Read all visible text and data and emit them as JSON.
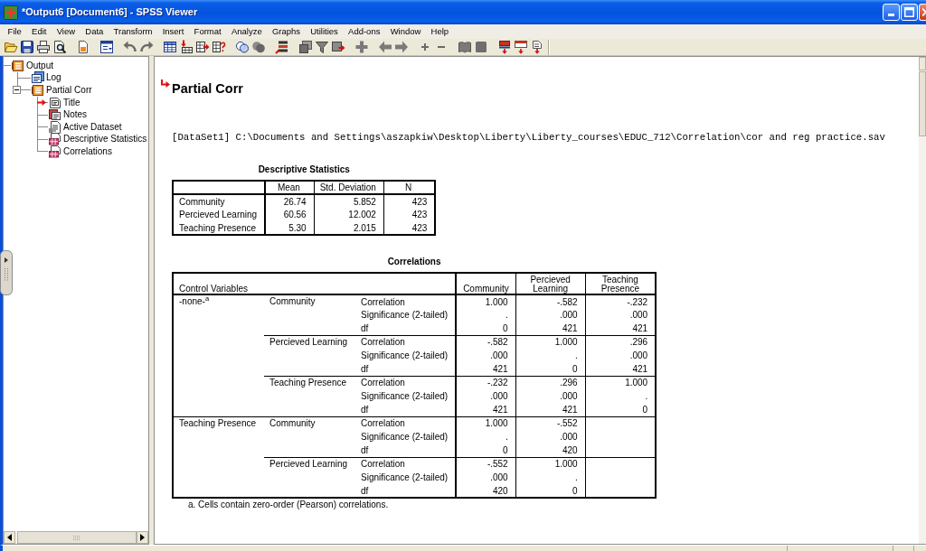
{
  "window": {
    "title": "*Output6 [Document6] - SPSS Viewer"
  },
  "menu": [
    "File",
    "Edit",
    "View",
    "Data",
    "Transform",
    "Insert",
    "Format",
    "Analyze",
    "Graphs",
    "Utilities",
    "Add-ons",
    "Window",
    "Help"
  ],
  "outline": [
    {
      "label": "Output",
      "kind": "heading",
      "current": false,
      "children": [
        {
          "label": "Log",
          "kind": "log",
          "current": false
        },
        {
          "label": "Partial Corr",
          "kind": "heading",
          "current": false,
          "expanded": true,
          "children": [
            {
              "label": "Title",
              "kind": "title",
              "current": true
            },
            {
              "label": "Notes",
              "kind": "notes",
              "current": false
            },
            {
              "label": "Active Dataset",
              "kind": "text",
              "current": false
            },
            {
              "label": "Descriptive Statistics",
              "kind": "table",
              "current": false
            },
            {
              "label": "Correlations",
              "kind": "table",
              "current": false
            }
          ]
        }
      ]
    }
  ],
  "output": {
    "title": {
      "text": "Partial Corr",
      "current": true
    },
    "dataset_line": "[DataSet1] C:\\Documents and Settings\\aszapkiw\\Desktop\\Liberty\\Liberty_courses\\EDUC_712\\Correlation\\cor and reg practice.sav",
    "descriptive_statistics": {
      "title": "Descriptive Statistics",
      "columns": [
        "Mean",
        "Std. Deviation",
        "N"
      ],
      "rows": [
        {
          "label": "Community",
          "cells": [
            "26.74",
            "5.852",
            "423"
          ]
        },
        {
          "label": "Percieved Learning",
          "cells": [
            "60.56",
            "12.002",
            "423"
          ]
        },
        {
          "label": "Teaching Presence",
          "cells": [
            "5.30",
            "2.015",
            "423"
          ]
        }
      ]
    },
    "correlations": {
      "title": "Correlations",
      "corner_label": "Control Variables",
      "columns": [
        "Community",
        "Percieved Learning",
        "Teaching Presence"
      ],
      "groups": [
        {
          "control": "-none-$^{a}$",
          "variables": [
            {
              "name": "Community",
              "stats": [
                {
                  "label": "Correlation",
                  "cells": [
                    "1.000",
                    "-.582",
                    "-.232"
                  ]
                },
                {
                  "label": "Significance (2-tailed)",
                  "cells": [
                    ".",
                    ".000",
                    ".000"
                  ]
                },
                {
                  "label": "df",
                  "cells": [
                    "0",
                    "421",
                    "421"
                  ]
                }
              ]
            },
            {
              "name": "Percieved Learning",
              "stats": [
                {
                  "label": "Correlation",
                  "cells": [
                    "-.582",
                    "1.000",
                    ".296"
                  ]
                },
                {
                  "label": "Significance (2-tailed)",
                  "cells": [
                    ".000",
                    ".",
                    ".000"
                  ]
                },
                {
                  "label": "df",
                  "cells": [
                    "421",
                    "0",
                    "421"
                  ]
                }
              ]
            },
            {
              "name": "Teaching Presence",
              "stats": [
                {
                  "label": "Correlation",
                  "cells": [
                    "-.232",
                    ".296",
                    "1.000"
                  ]
                },
                {
                  "label": "Significance (2-tailed)",
                  "cells": [
                    ".000",
                    ".000",
                    "."
                  ]
                },
                {
                  "label": "df",
                  "cells": [
                    "421",
                    "421",
                    "0"
                  ]
                }
              ]
            }
          ]
        },
        {
          "control": "Teaching Presence",
          "variables": [
            {
              "name": "Community",
              "stats": [
                {
                  "label": "Correlation",
                  "cells": [
                    "1.000",
                    "-.552"
                  ]
                },
                {
                  "label": "Significance (2-tailed)",
                  "cells": [
                    ".",
                    ".000"
                  ]
                },
                {
                  "label": "df",
                  "cells": [
                    "0",
                    "420"
                  ]
                }
              ]
            },
            {
              "name": "Percieved Learning",
              "stats": [
                {
                  "label": "Correlation",
                  "cells": [
                    "-.552",
                    "1.000"
                  ]
                },
                {
                  "label": "Significance (2-tailed)",
                  "cells": [
                    ".000",
                    "."
                  ]
                },
                {
                  "label": "df",
                  "cells": [
                    "420",
                    "0"
                  ]
                }
              ]
            }
          ]
        }
      ],
      "footnote": "a. Cells contain zero-order (Pearson) correlations."
    }
  }
}
